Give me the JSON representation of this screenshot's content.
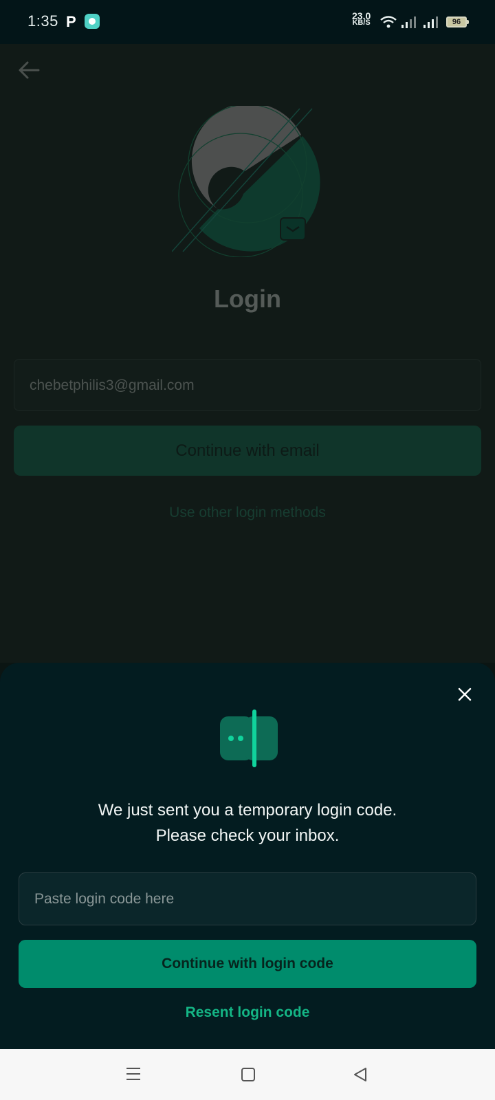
{
  "status_bar": {
    "time": "1:35",
    "notification_letter": "P",
    "net_speed_value": "23.0",
    "net_speed_unit": "KB/S",
    "battery": "96"
  },
  "login": {
    "title": "Login",
    "email_value": "chebetphilis3@gmail.com",
    "continue_email_label": "Continue with email",
    "other_methods_label": "Use other login methods"
  },
  "sheet": {
    "message_line1": "We just sent you a temporary login code.",
    "message_line2": "Please check your inbox.",
    "code_placeholder": "Paste login code here",
    "continue_code_label": "Continue with login code",
    "resend_label": "Resent login code"
  },
  "icons": {
    "back": "arrow-left-icon",
    "close": "close-icon",
    "sheet": "login-code-icon",
    "mail": "mail-icon"
  },
  "colors": {
    "accent": "#008c6c",
    "link": "#14b585",
    "sheet_bg": "#031c20"
  }
}
